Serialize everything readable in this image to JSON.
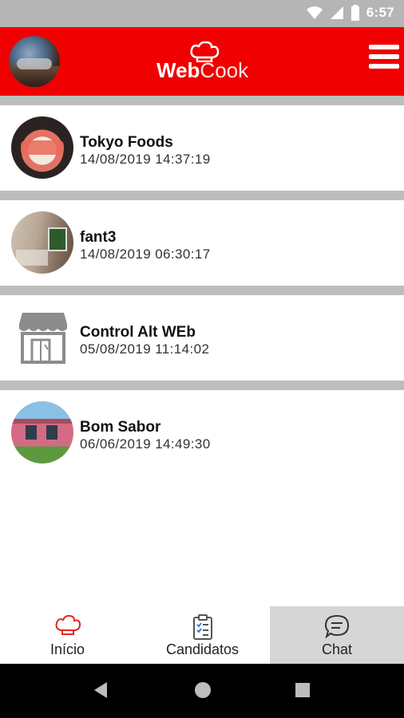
{
  "statusbar": {
    "time": "6:57"
  },
  "appbar": {
    "logo_bold": "Web",
    "logo_thin": "Cook"
  },
  "chats": [
    {
      "name": "Tokyo Foods",
      "date": "14/08/2019 14:37:19"
    },
    {
      "name": "fant3",
      "date": "14/08/2019 06:30:17"
    },
    {
      "name": "Control Alt WEb",
      "date": "05/08/2019 11:14:02"
    },
    {
      "name": "Bom Sabor",
      "date": "06/06/2019 14:49:30"
    }
  ],
  "nav": {
    "tabs": [
      {
        "label": "Início",
        "icon": "chef-hat-icon"
      },
      {
        "label": "Candidatos",
        "icon": "clipboard-checklist-icon"
      },
      {
        "label": "Chat",
        "icon": "chat-bubble-icon"
      }
    ],
    "active": "Chat"
  },
  "colors": {
    "brand_red": "#f00000",
    "separator": "#bdbdbd",
    "active_tab": "#d6d6d6"
  }
}
